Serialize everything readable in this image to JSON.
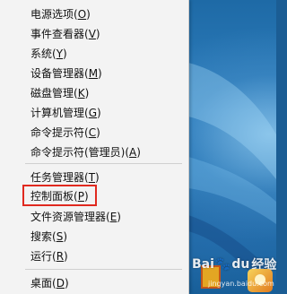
{
  "menu": {
    "items": [
      {
        "label": "电源选项(",
        "key": "O",
        "suffix": ")"
      },
      {
        "label": "事件查看器(",
        "key": "V",
        "suffix": ")"
      },
      {
        "label": "系统(",
        "key": "Y",
        "suffix": ")"
      },
      {
        "label": "设备管理器(",
        "key": "M",
        "suffix": ")"
      },
      {
        "label": "磁盘管理(",
        "key": "K",
        "suffix": ")"
      },
      {
        "label": "计算机管理(",
        "key": "G",
        "suffix": ")"
      },
      {
        "label": "命令提示符(",
        "key": "C",
        "suffix": ")"
      },
      {
        "label": "命令提示符(管理员)(",
        "key": "A",
        "suffix": ")"
      },
      {
        "label": "任务管理器(",
        "key": "T",
        "suffix": ")"
      },
      {
        "label": "控制面板(",
        "key": "P",
        "suffix": ")"
      },
      {
        "label": "文件资源管理器(",
        "key": "E",
        "suffix": ")"
      },
      {
        "label": "搜索(",
        "key": "S",
        "suffix": ")"
      },
      {
        "label": "运行(",
        "key": "R",
        "suffix": ")"
      },
      {
        "label": "桌面(",
        "key": "D",
        "suffix": ")"
      }
    ],
    "highlighted_item": "控制面板(P)",
    "highlight_color": "#e0291f"
  },
  "watermark": {
    "brand": "Bai",
    "brand_tail": "du",
    "suffix": "经验",
    "url": "jingyan.baidu.com",
    "icon": "baidu-paw-icon"
  },
  "colors": {
    "menu_background": "#f3f3f3",
    "desktop_blue": "#2f7fbf"
  }
}
